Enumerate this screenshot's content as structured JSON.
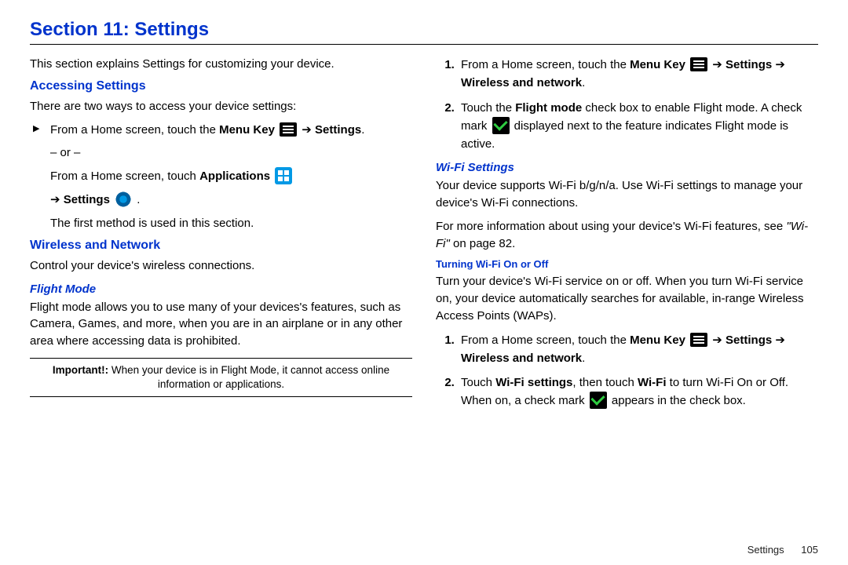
{
  "section_title": "Section 11: Settings",
  "footer": {
    "label": "Settings",
    "page": "105"
  },
  "arrows": {
    "right": "➔"
  },
  "left": {
    "intro": "This section explains Settings for customizing your device.",
    "accessing": {
      "heading": "Accessing Settings",
      "lead": "There are two ways to access your device settings:",
      "item1_a": "From a Home screen, touch the ",
      "item1_menu_key": "Menu Key",
      "item1_b": " ",
      "item1_settings": "Settings",
      "item1_c": ".",
      "or": "– or –",
      "item2_a": "From a Home screen, touch ",
      "item2_apps": "Applications",
      "item2_b": " ",
      "item2_settings": "Settings",
      "item2_c": " .",
      "note": "The first method is used in this section."
    },
    "wireless": {
      "heading": "Wireless and Network",
      "lead": "Control your device's wireless connections."
    },
    "flightmode": {
      "heading": "Flight Mode",
      "body": "Flight mode allows you to use many of your devices's features, such as Camera, Games, and more, when you are in an airplane or in any other area where accessing data is prohibited.",
      "important_label": "Important!:",
      "important_text": " When your device is in Flight Mode, it cannot access online information or applications."
    }
  },
  "right": {
    "steps1": {
      "s1_a": "From a Home screen, touch the ",
      "s1_menu_key": "Menu Key",
      "s1_b": " ",
      "s1_settings": "Settings",
      "s1_c": " ",
      "s1_wireless": "Wireless and network",
      "s1_d": ".",
      "s2_a": "Touch the ",
      "s2_fm": "Flight mode",
      "s2_b": " check box to enable Flight mode. A check mark ",
      "s2_c": " displayed next to the feature indicates Flight mode is active."
    },
    "wifi": {
      "heading": "Wi-Fi Settings",
      "body": "Your device supports Wi-Fi b/g/n/a. Use Wi-Fi settings to manage your device's Wi-Fi connections.",
      "more_a": "For more information about using your device's Wi-Fi features, see ",
      "more_ref": "\"Wi-Fi\"",
      "more_b": " on page 82."
    },
    "turning": {
      "heading": "Turning Wi-Fi On or Off",
      "body": "Turn your device's Wi-Fi service on or off. When you turn Wi-Fi service on, your device automatically searches for available, in-range Wireless Access Points (WAPs).",
      "s1_a": "From a Home screen, touch the ",
      "s1_menu_key": "Menu Key",
      "s1_b": " ",
      "s1_settings": "Settings",
      "s1_c": " ",
      "s1_wireless": "Wireless and network",
      "s1_d": ".",
      "s2_a": "Touch ",
      "s2_ws": "Wi-Fi settings",
      "s2_b": ", then touch ",
      "s2_wf": "Wi-Fi",
      "s2_c": " to turn Wi-Fi On or Off. When on, a check mark ",
      "s2_d": " appears in the check box."
    }
  }
}
